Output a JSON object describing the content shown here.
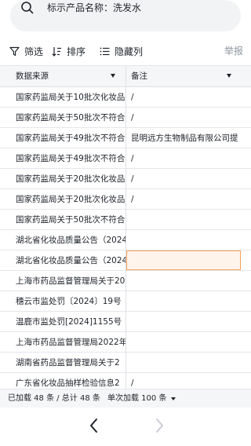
{
  "search": {
    "text": "标示产品名称：洗发水",
    "icon": "search-icon"
  },
  "toolbar": {
    "filter_label": "筛选",
    "sort_label": "排序",
    "hide_label": "隐藏列",
    "report_label": "举报"
  },
  "table": {
    "columns": [
      {
        "label": "数据来源"
      },
      {
        "label": "备注"
      }
    ],
    "rows": [
      {
        "source": "国家药监局关于10批次化妆品",
        "note": "/"
      },
      {
        "source": "国家药监局关于50批次不符合",
        "note": "/"
      },
      {
        "source": "国家药监局关于49批次不符合",
        "note": "昆明远方生物制品有限公司提"
      },
      {
        "source": "国家药监局关于49批次不符合",
        "note": "/"
      },
      {
        "source": "国家药监局关于20批次化妆品",
        "note": "/"
      },
      {
        "source": "国家药监局关于20批次化妆品",
        "note": "/"
      },
      {
        "source": "国家药监局关于50批次不符合",
        "note": ""
      },
      {
        "source": "湖北省化妆品质量公告（2024",
        "note": ""
      },
      {
        "source": "湖北省化妆品质量公告（2024",
        "note": ""
      },
      {
        "source": "上海市药品监督管理局关于20",
        "note": ""
      },
      {
        "source": "穗云市监处罚〔2024〕19号",
        "note": ""
      },
      {
        "source": "温鹿市监处罚[2024]1155号",
        "note": ""
      },
      {
        "source": "上海市药品监督管理局2022年",
        "note": ""
      },
      {
        "source": "湖南省药品监督管理局关于2",
        "note": ""
      },
      {
        "source": "广东省化妆品抽样检验信息2",
        "note": "/"
      }
    ]
  },
  "status": {
    "loaded": "已加载 48 条 / 总计 48 条",
    "batch": "单次加载 100 条"
  },
  "colors": {
    "selected_fill": "#fff4ec",
    "selected_border": "#f5a05a",
    "header_bg": "#f5f6f7"
  }
}
